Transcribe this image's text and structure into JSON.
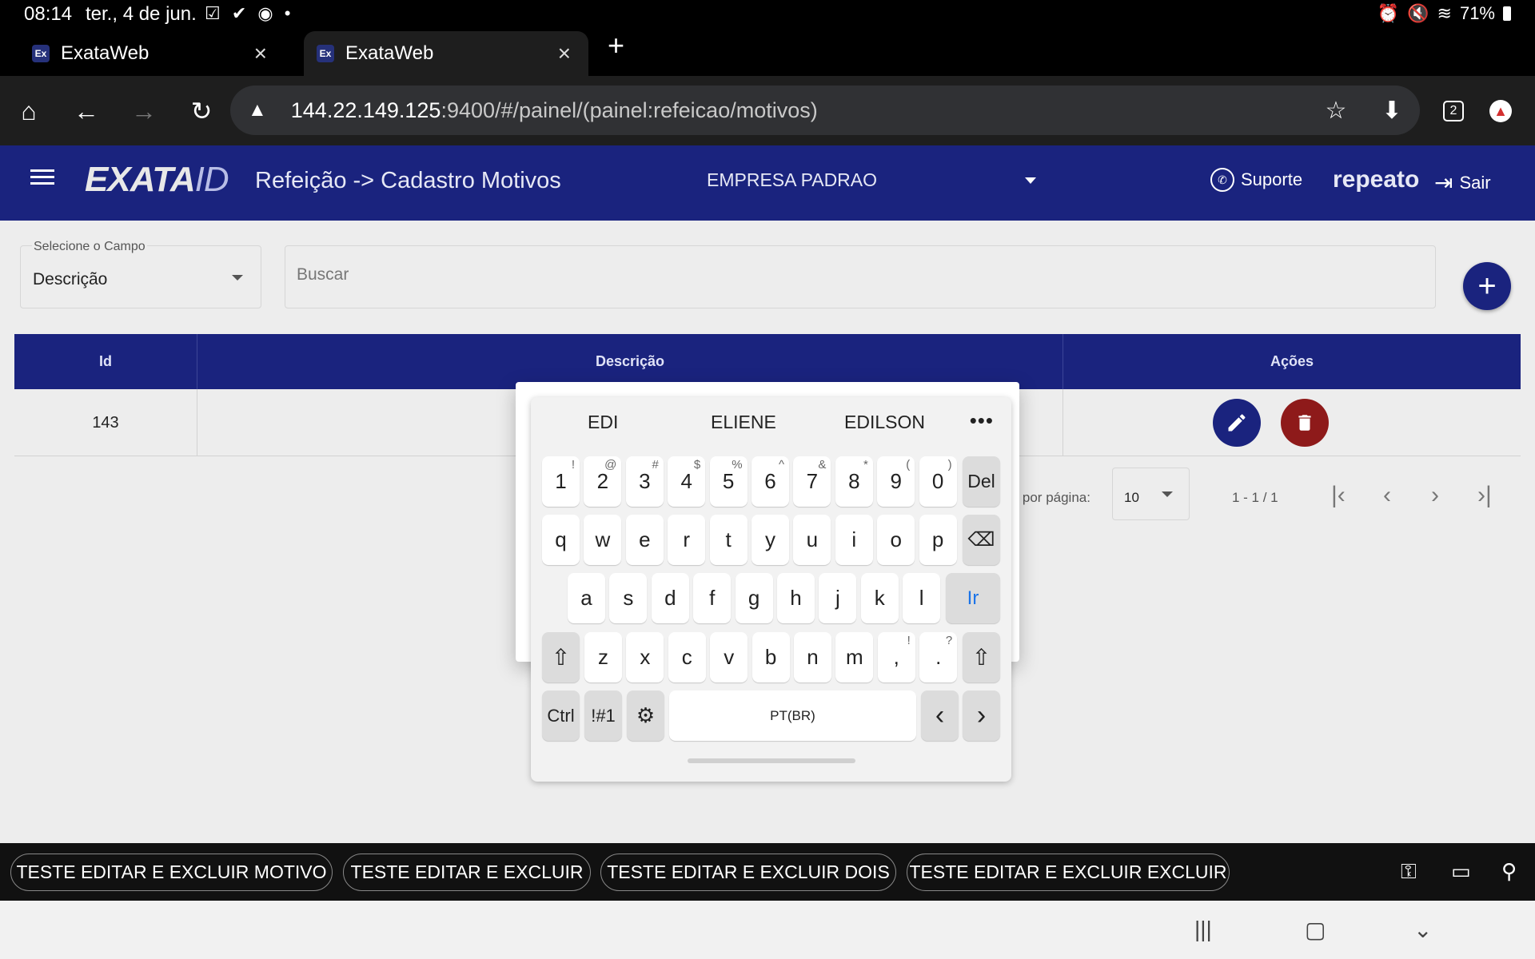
{
  "status_bar": {
    "time": "08:14",
    "date": "ter., 4 de jun.",
    "battery": "71%"
  },
  "browser": {
    "tabs": [
      {
        "title": "ExataWeb",
        "favicon": "Ex",
        "active": false
      },
      {
        "title": "ExataWeb",
        "favicon": "Ex",
        "active": true
      }
    ],
    "url_host": "144.22.149.125",
    "url_path": ":9400/#/painel/(painel:refeicao/motivos)",
    "tab_count": "2"
  },
  "app_header": {
    "logo_text": "EXATA",
    "logo_suffix": "ID",
    "page_title": "Refeição -> Cadastro Motivos",
    "company": "EMPRESA PADRAO",
    "support_label": "Suporte",
    "username": "repeato",
    "logout_label": "Sair"
  },
  "filter": {
    "field_label": "Selecione o Campo",
    "field_value": "Descrição",
    "search_placeholder": "Buscar"
  },
  "table": {
    "headers": {
      "id": "Id",
      "description": "Descrição",
      "actions": "Ações"
    },
    "rows": [
      {
        "id": "143",
        "description": ""
      }
    ]
  },
  "paginator": {
    "per_page_label": "d. por página:",
    "per_page_value": "10",
    "range": "1 - 1 / 1"
  },
  "keyboard": {
    "suggestions": [
      "EDI",
      "ELIENE",
      "EDILSON"
    ],
    "number_row": [
      "1",
      "2",
      "3",
      "4",
      "5",
      "6",
      "7",
      "8",
      "9",
      "0"
    ],
    "number_sup": [
      "!",
      "@",
      "#",
      "$",
      "%",
      "^",
      "&",
      "*",
      "(",
      ")"
    ],
    "row_q": [
      "q",
      "w",
      "e",
      "r",
      "t",
      "y",
      "u",
      "i",
      "o",
      "p"
    ],
    "row_a": [
      "a",
      "s",
      "d",
      "f",
      "g",
      "h",
      "j",
      "k",
      "l"
    ],
    "row_z": [
      "z",
      "x",
      "c",
      "v",
      "b",
      "n",
      "m"
    ],
    "comma": ",",
    "comma_sup": "!",
    "period": ".",
    "period_sup": "?",
    "del_label": "Del",
    "go_label": "Ir",
    "ctrl_label": "Ctrl",
    "symbols_label": "!#1",
    "space_label": "PT(BR)",
    "accent_color": "#1a73e8"
  },
  "bottom_chips": [
    "TESTE EDITAR E EXCLUIR MOTIVO",
    "TESTE EDITAR E EXCLUIR",
    "TESTE EDITAR E EXCLUIR DOIS",
    "TESTE EDITAR E EXCLUIR EXCLUIR"
  ],
  "colors": {
    "brand": "#1a237e",
    "delete": "#8e1a1a"
  }
}
